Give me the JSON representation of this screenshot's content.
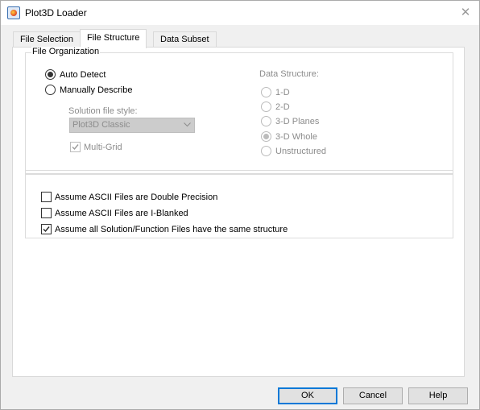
{
  "window": {
    "title": "Plot3D Loader",
    "close_glyph": "✕"
  },
  "tabs": [
    {
      "label": "File Selection",
      "active": false
    },
    {
      "label": "File Structure",
      "active": true
    },
    {
      "label": "Data Subset",
      "active": false
    }
  ],
  "file_organization": {
    "title": "File Organization",
    "auto_detect": {
      "label": "Auto Detect",
      "selected": true
    },
    "manually_describe": {
      "label": "Manually Describe",
      "selected": false
    },
    "solution_style_label": "Solution file style:",
    "solution_style_value": "Plot3D Classic",
    "multi_grid": {
      "label": "Multi-Grid",
      "checked": true,
      "enabled": false
    }
  },
  "data_structure": {
    "label": "Data Structure:",
    "options": [
      {
        "label": "1-D",
        "selected": false
      },
      {
        "label": "2-D",
        "selected": false
      },
      {
        "label": "3-D Planes",
        "selected": false
      },
      {
        "label": "3-D Whole",
        "selected": true
      },
      {
        "label": "Unstructured",
        "selected": false
      }
    ]
  },
  "options": [
    {
      "label": "Assume ASCII Files are Double Precision",
      "checked": false
    },
    {
      "label": "Assume ASCII Files are I-Blanked",
      "checked": false
    },
    {
      "label": "Assume all Solution/Function Files have the same structure",
      "checked": true
    }
  ],
  "buttons": {
    "ok": "OK",
    "cancel": "Cancel",
    "help": "Help"
  },
  "colors": {
    "accent": "#0078d7",
    "disabled_text": "#8c8c8c"
  }
}
